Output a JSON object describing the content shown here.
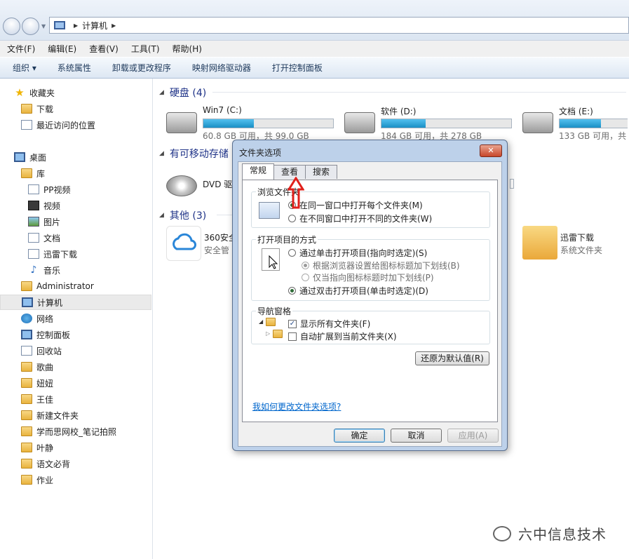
{
  "address": {
    "crumb": "计算机"
  },
  "menu": [
    "文件(F)",
    "编辑(E)",
    "查看(V)",
    "工具(T)",
    "帮助(H)"
  ],
  "toolbar": {
    "organize": "组织 ▾",
    "system_props": "系统属性",
    "uninstall": "卸载或更改程序",
    "map_drive": "映射网络驱动器",
    "control_panel": "打开控制面板"
  },
  "sidebar": {
    "favorites": "收藏夹",
    "downloads": "下载",
    "recent": "最近访问的位置",
    "desktop": "桌面",
    "libraries": "库",
    "pp_video": "PP视频",
    "video": "视频",
    "pictures": "图片",
    "documents": "文档",
    "thunder_dl": "迅雷下载",
    "music": "音乐",
    "administrator": "Administrator",
    "computer": "计算机",
    "network": "网络",
    "control_panel": "控制面板",
    "recycle": "回收站",
    "songs": "歌曲",
    "niuniu": "妞妞",
    "wangjia": "王佳",
    "new_folder": "新建文件夹",
    "xueersi": "学而思网校_笔记拍照",
    "yejing": "叶静",
    "yuwen": "语文必背",
    "homework": "作业"
  },
  "content": {
    "hdd_group": "硬盘 (4)",
    "drives": [
      {
        "name": "Win7 (C:)",
        "info": "60.8 GB 可用，共 99.0 GB",
        "used": 0.39
      },
      {
        "name": "软件 (D:)",
        "info": "184 GB 可用，共 278 GB",
        "used": 0.34
      },
      {
        "name": "文档 (E:)",
        "info": "133 GB 可用，共 2",
        "used": 0.6
      }
    ],
    "removable_group": "有可移动存储",
    "dvd_name": "DVD 驱",
    "other_group": "其他 (3)",
    "app_360_name": "360安全",
    "app_360_desc": "安全管",
    "thunder_name": "迅雷下载",
    "thunder_desc": "系统文件夹"
  },
  "dialog": {
    "title": "文件夹选项",
    "close": "✕",
    "tabs": [
      "常规",
      "查看",
      "搜索"
    ],
    "browse_label": "浏览文件夹",
    "browse_same": "在同一窗口中打开每个文件夹(M)",
    "browse_new": "在不同窗口中打开不同的文件夹(W)",
    "click_label": "打开项目的方式",
    "single_click": "通过单击打开项目(指向时选定)(S)",
    "underline_browser": "根据浏览器设置给图标标题加下划线(B)",
    "underline_hover": "仅当指向图标标题时加下划线(P)",
    "double_click": "通过双击打开项目(单击时选定)(D)",
    "nav_label": "导航窗格",
    "show_all": "显示所有文件夹(F)",
    "auto_expand": "自动扩展到当前文件夹(X)",
    "restore": "还原为默认值(R)",
    "help_link": "我如何更改文件夹选项?",
    "ok": "确定",
    "cancel": "取消",
    "apply": "应用(A)"
  },
  "watermark": "六中信息技术"
}
